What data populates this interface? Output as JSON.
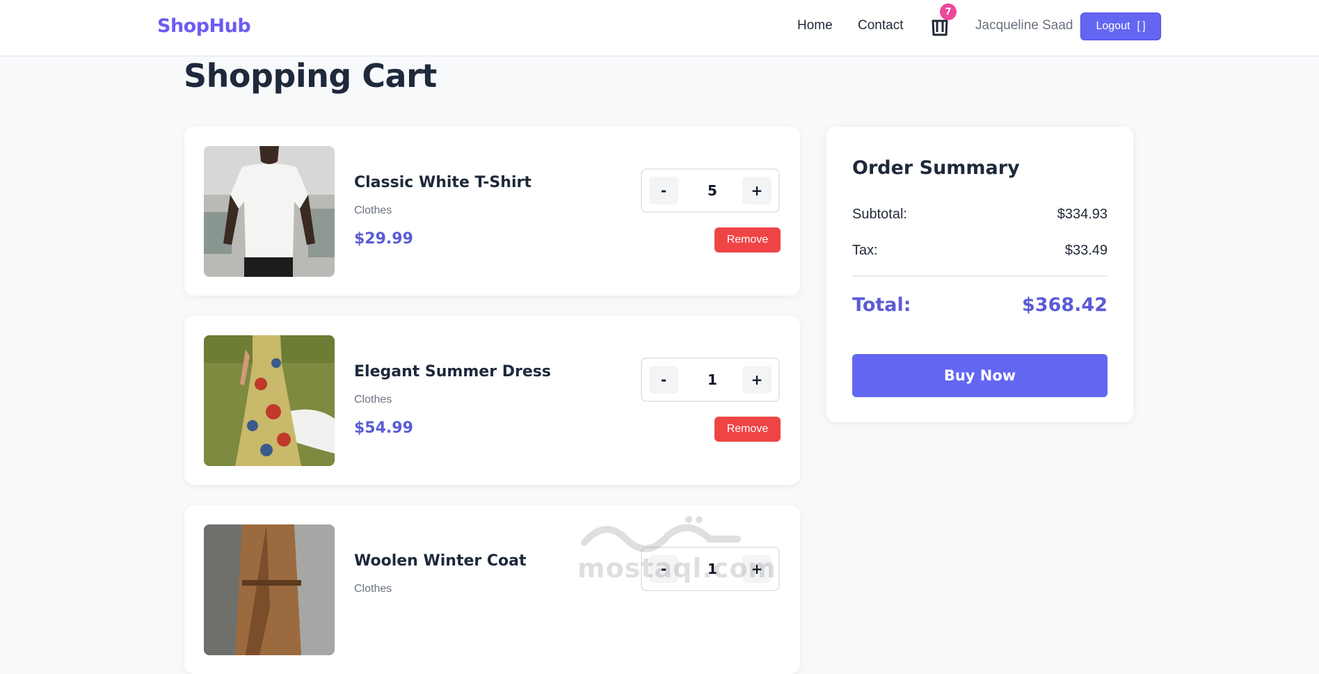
{
  "navbar": {
    "brand": "ShopHub",
    "links": [
      "Home",
      "Contact"
    ],
    "cart_count": "7",
    "user_name": "Jacqueline Saad",
    "logout_label": "Logout",
    "logout_icon": "sign-out-icon",
    "cart_icon": "shopping-bag-icon"
  },
  "page": {
    "title": "Shopping Cart"
  },
  "cart_items": [
    {
      "name": "Classic White T-Shirt",
      "category": "Clothes",
      "price": "$29.99",
      "quantity": "5",
      "remove_label": "Remove",
      "image": "white-tshirt-photo"
    },
    {
      "name": "Elegant Summer Dress",
      "category": "Clothes",
      "price": "$54.99",
      "quantity": "1",
      "remove_label": "Remove",
      "image": "floral-dress-photo"
    },
    {
      "name": "Woolen Winter Coat",
      "category": "Clothes",
      "price": "",
      "quantity": "1",
      "remove_label": "",
      "image": "brown-coat-photo"
    }
  ],
  "qty_controls": {
    "minus": "-",
    "plus": "+"
  },
  "summary": {
    "title": "Order Summary",
    "subtotal_label": "Subtotal:",
    "subtotal_value": "$334.93",
    "tax_label": "Tax:",
    "tax_value": "$33.49",
    "total_label": "Total:",
    "total_value": "$368.42",
    "buy_label": "Buy Now"
  },
  "watermark": {
    "latin": "mostaql.com"
  },
  "colors": {
    "brand": "#6b5cf5",
    "accent": "#6366f1",
    "price": "#5b5bd6",
    "danger": "#ef4444",
    "badge": "#ec4899",
    "background": "#f8f9fb"
  }
}
